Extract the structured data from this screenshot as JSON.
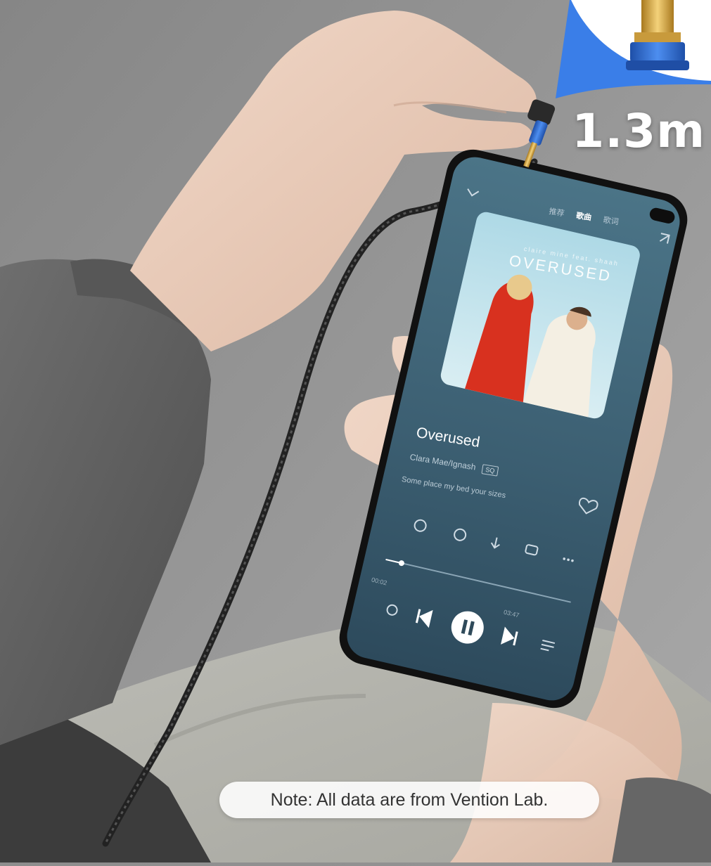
{
  "spec": {
    "length_label": "1.3m"
  },
  "player": {
    "tabs": [
      "推荐",
      "歌曲",
      "歌词"
    ],
    "album_small": "claire mine feat. shaah",
    "album_title": "OVERUSED",
    "song_title": "Overused",
    "artist": "Clara Mae/Ignash",
    "quality": "SQ",
    "lyric": "Some place my bed your sizes",
    "elapsed": "00:02",
    "total": "03:47"
  },
  "note": {
    "text": "Note: All data are from Vention Lab."
  },
  "colors": {
    "cable_head": "#2f6fd1",
    "screen_bg": "#3f6377",
    "gold": "#d8a83c"
  }
}
